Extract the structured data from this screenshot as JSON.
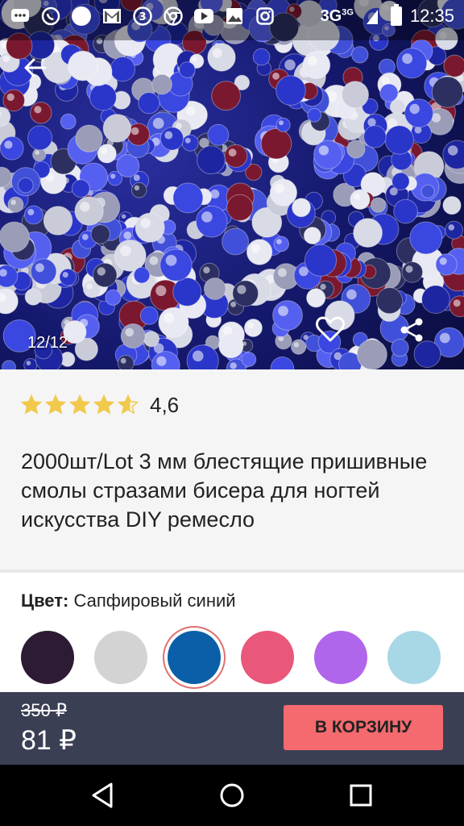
{
  "status_bar": {
    "network": "3G",
    "network_sup": "3G",
    "time": "12:35",
    "icons": [
      "chat-icon",
      "whatsapp-icon",
      "circle-icon",
      "gmail-icon",
      "three-icon",
      "chrome-icon",
      "youtube-icon",
      "photos-icon",
      "instagram-icon"
    ]
  },
  "gallery": {
    "counter": "12/12"
  },
  "product": {
    "rating": 4.6,
    "rating_text": "4,6",
    "title": "2000шт/Lot 3 мм блестящие пришивные смолы стразами бисера для ногтей искусства DIY ремесло"
  },
  "color": {
    "label": "Цвет:",
    "selected_name": "Сапфировый синий",
    "swatches": [
      {
        "color": "#2d1a33",
        "selected": false
      },
      {
        "color": "#d3d3d3",
        "selected": false
      },
      {
        "color": "#0b5fa8",
        "selected": true
      },
      {
        "color": "#e9577a",
        "selected": false
      },
      {
        "color": "#b066ea",
        "selected": false
      },
      {
        "color": "#a8d7e6",
        "selected": false
      }
    ]
  },
  "purchase": {
    "old_price": "350 ₽",
    "price": "81 ₽",
    "cart_label": "В КОРЗИНУ"
  },
  "colors": {
    "accent": "#f46a6f",
    "bar": "#3b3f54",
    "star": "#f2c94c"
  }
}
